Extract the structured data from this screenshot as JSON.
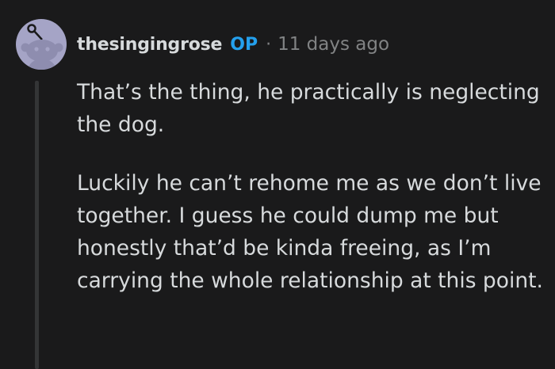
{
  "comment": {
    "author": "thesingingrose",
    "op_badge": "OP",
    "separator": "·",
    "timestamp": "11 days ago",
    "paragraphs": [
      "That’s the thing, he practically is neglecting the dog.",
      "Luckily he can’t rehome me as we don’t live together. I guess he could dump me but honestly that’d be kinda freeing, as I’m carrying the whole relationship at this point."
    ]
  },
  "colors": {
    "background": "#1a1a1b",
    "text": "#d7dadc",
    "muted": "#818384",
    "op_accent": "#24a0ed",
    "avatar_bg": "#a5a4c6",
    "thread_line": "#343536"
  },
  "icons": {
    "avatar": "reddit-snoo-avatar-icon"
  }
}
